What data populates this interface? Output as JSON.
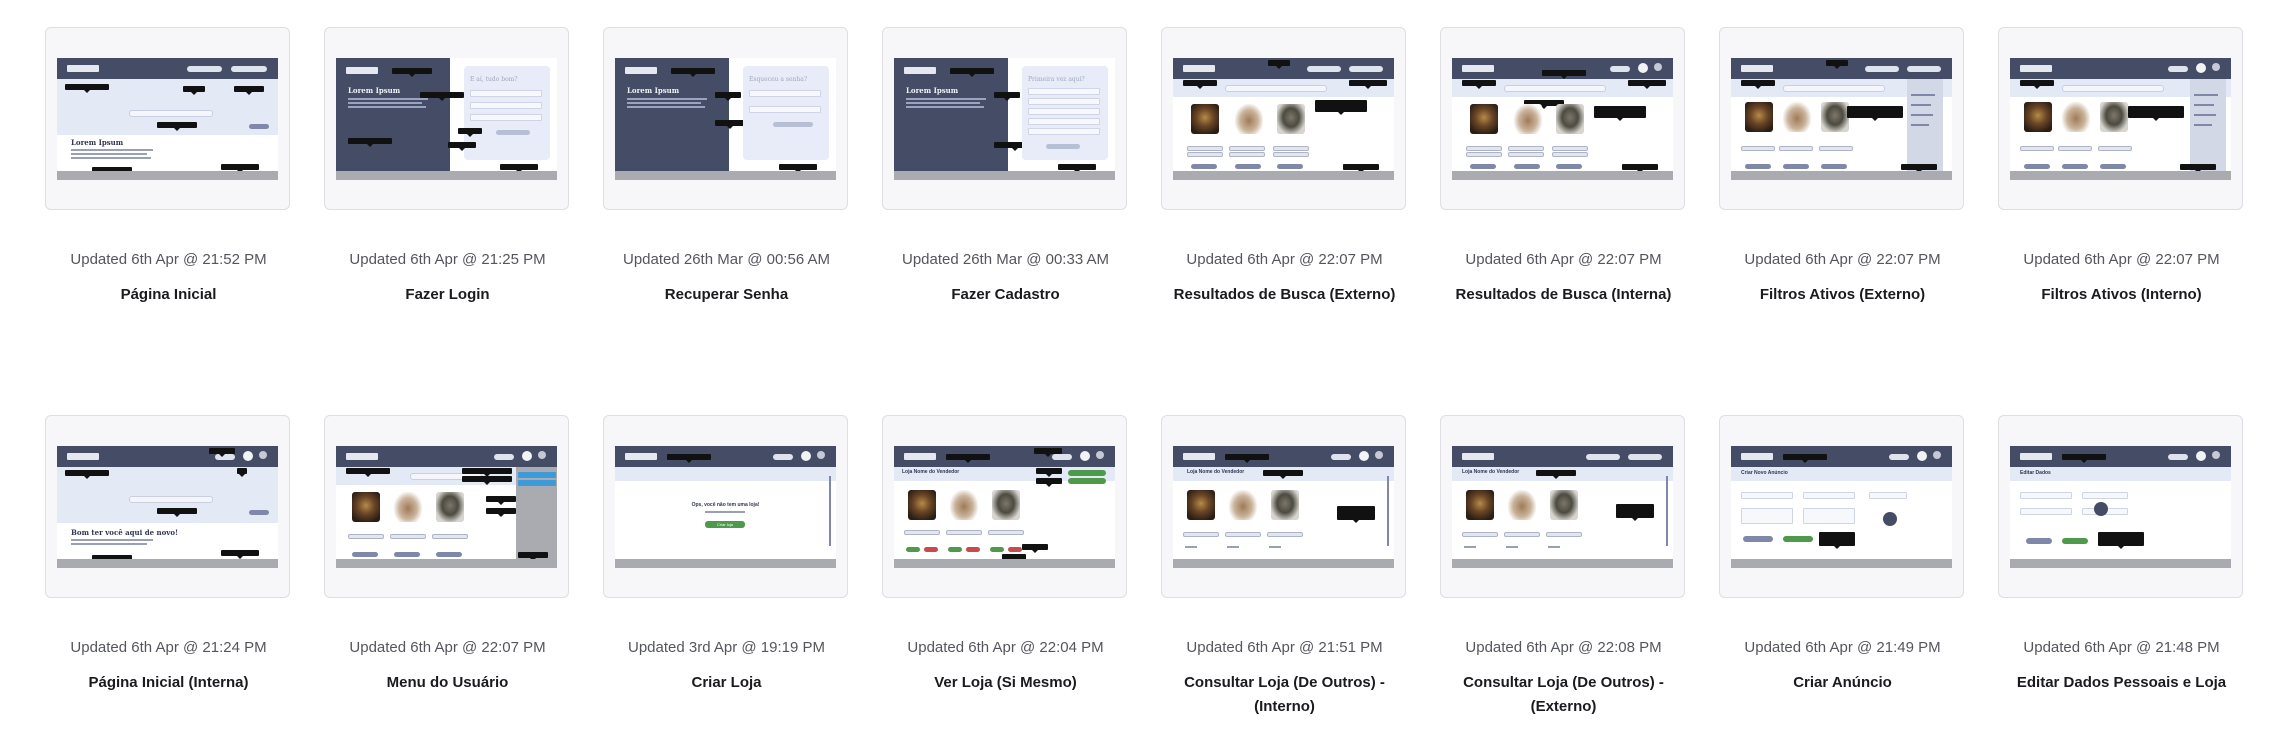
{
  "cards": [
    {
      "updated": "Updated 6th Apr @ 21:52 PM",
      "title": "Página Inicial",
      "thumb_heading": "Lorem Ipsum"
    },
    {
      "updated": "Updated 6th Apr @ 21:25 PM",
      "title": "Fazer Login",
      "thumb_heading": "Lorem Ipsum",
      "thumb_form_heading": "E aí, tudo bom?"
    },
    {
      "updated": "Updated 26th Mar @ 00:56 AM",
      "title": "Recuperar Senha",
      "thumb_heading": "Lorem Ipsum",
      "thumb_form_heading": "Esqueceu a senha?"
    },
    {
      "updated": "Updated 26th Mar @ 00:33 AM",
      "title": "Fazer Cadastro",
      "thumb_heading": "Lorem Ipsum",
      "thumb_form_heading": "Primeira vez aqui?"
    },
    {
      "updated": "Updated 6th Apr @ 22:07 PM",
      "title": "Resultados de Busca (Externo)"
    },
    {
      "updated": "Updated 6th Apr @ 22:07 PM",
      "title": "Resultados de Busca (Interna)"
    },
    {
      "updated": "Updated 6th Apr @ 22:07 PM",
      "title": "Filtros Ativos (Externo)"
    },
    {
      "updated": "Updated 6th Apr @ 22:07 PM",
      "title": "Filtros Ativos (Interno)"
    },
    {
      "updated": "Updated 6th Apr @ 21:24 PM",
      "title": "Página Inicial (Interna)",
      "thumb_heading": "Bom ter você aqui de novo!"
    },
    {
      "updated": "Updated 6th Apr @ 22:07 PM",
      "title": "Menu do Usuário"
    },
    {
      "updated": "Updated 3rd Apr @ 19:19 PM",
      "title": "Criar Loja",
      "thumb_message": "Ops, você não tem uma loja!",
      "thumb_button": "Criar loja"
    },
    {
      "updated": "Updated 6th Apr @ 22:04 PM",
      "title": "Ver Loja (Si Mesmo)",
      "thumb_heading": "Loja Nome do Vendedor"
    },
    {
      "updated": "Updated 6th Apr @ 21:51 PM",
      "title": "Consultar Loja (De Outros) - (Interno)",
      "thumb_heading": "Loja Nome do Vendedor"
    },
    {
      "updated": "Updated 6th Apr @ 22:08 PM",
      "title": "Consultar Loja (De Outros) - (Externo)",
      "thumb_heading": "Loja Nome do Vendedor"
    },
    {
      "updated": "Updated 6th Apr @ 21:49 PM",
      "title": "Criar Anúncio",
      "thumb_heading": "Criar Novo Anúncio"
    },
    {
      "updated": "Updated 6th Apr @ 21:48 PM",
      "title": "Editar Dados Pessoais e Loja",
      "thumb_heading": "Editar Dados"
    }
  ],
  "colors": {
    "topbar": "#454c65",
    "band": "#e4e9f6",
    "footer": "#a9abb1",
    "tooltip": "#111111",
    "green_button": "#4f9a4a",
    "red_button": "#c94a4a",
    "blue_menu": "#3c9bd8"
  }
}
